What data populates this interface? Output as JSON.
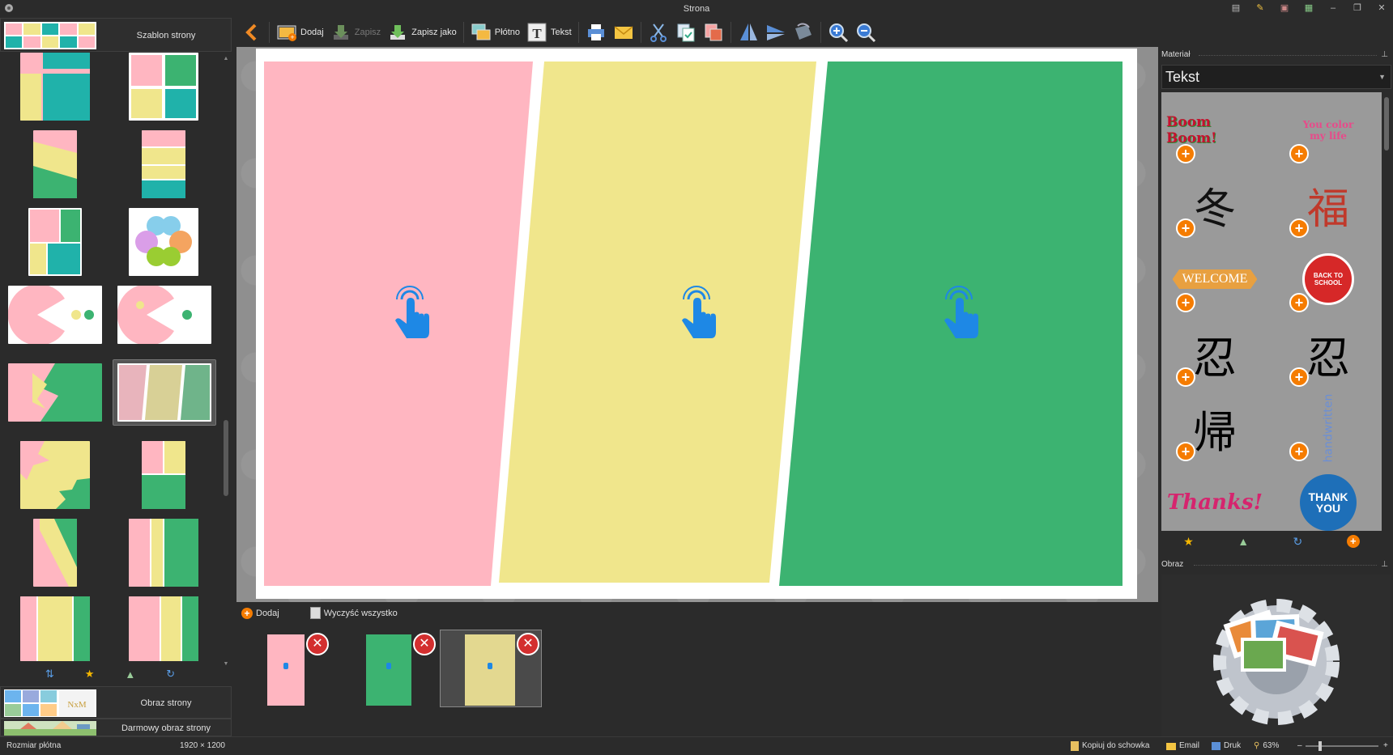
{
  "window": {
    "title": "Strona"
  },
  "left_panel": {
    "template_header_label": "Szablon strony",
    "page_image_label": "Obraz strony",
    "page_image_thumb_text": "NxM",
    "free_image_label": "Darmowy obraz strony"
  },
  "toolbar": {
    "back_icon": "arrow-left-icon",
    "add_label": "Dodaj",
    "save_label": "Zapisz",
    "save_as_label": "Zapisz jako",
    "canvas_label": "Płótno",
    "text_label": "Tekst"
  },
  "canvas": {
    "panel_colors": [
      "#ffb6c1",
      "#f0e68c",
      "#3cb371"
    ],
    "hand_color": "#1e88e5"
  },
  "page_strip": {
    "add_label": "Dodaj",
    "clear_label": "Wyczyść wszystko",
    "thumb_colors": [
      "#ffb6c1",
      "#3cb371",
      "#f0e68c"
    ]
  },
  "right_panel": {
    "material_header": "Materiał",
    "category_value": "Tekst",
    "image_header": "Obraz",
    "stickers": [
      "Boom Boom!",
      "You color my life",
      "冬",
      "福",
      "WELCOME",
      "BACK TO SCHOOL",
      "忍",
      "忍",
      "帰",
      "handwritten",
      "Thanks!",
      "THANK YOU"
    ]
  },
  "statusbar": {
    "canvas_size_label": "Rozmiar płótna",
    "canvas_size_value": "1920 × 1200",
    "copy_label": "Kopiuj do schowka",
    "email_label": "Email",
    "print_label": "Druk",
    "zoom_label": "63%"
  },
  "colors": {
    "pink": "#ffb6c1",
    "yellow": "#f0e68c",
    "green": "#3cb371",
    "teal": "#20b2aa",
    "orange": "#f57c00"
  }
}
